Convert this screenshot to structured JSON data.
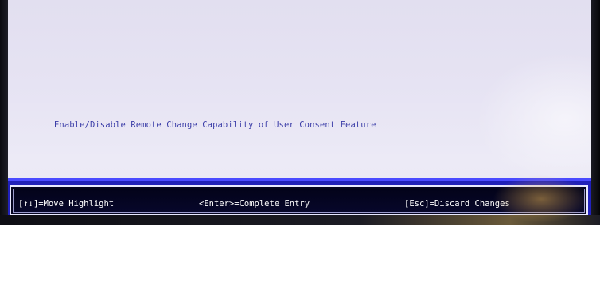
{
  "screen": {
    "help_text": "Enable/Disable Remote Change Capability of User Consent Feature"
  },
  "footer": {
    "move_highlight": "[↑↓]=Move Highlight",
    "complete_entry": "<Enter>=Complete Entry",
    "discard_changes": "[Esc]=Discard Changes"
  },
  "colors": {
    "screen_background": "#e6e3f3",
    "help_text": "#3c3ea8",
    "footer_bar": "#2424c4",
    "footer_box": "#05051f",
    "footer_text": "#ffffff"
  }
}
